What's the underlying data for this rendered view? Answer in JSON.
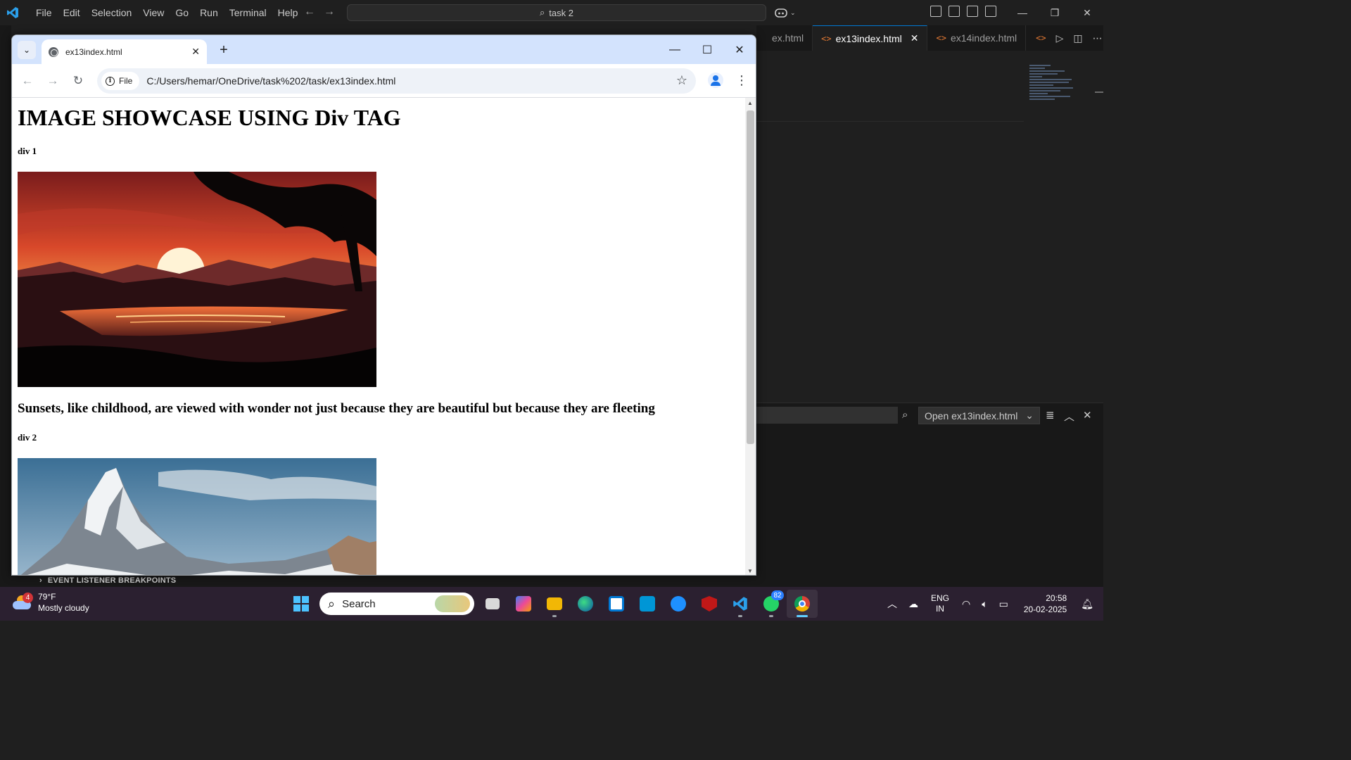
{
  "vscode": {
    "menu": [
      "File",
      "Edit",
      "Selection",
      "View",
      "Go",
      "Run",
      "Terminal",
      "Help"
    ],
    "command_center": "task 2",
    "tabs": [
      {
        "label": "ex.html",
        "active": false
      },
      {
        "label": "ex13index.html",
        "active": true
      },
      {
        "label": "ex14index.html",
        "active": false
      }
    ],
    "output_dropdown": "Open ex13index.html",
    "breakpoints_label": "EVENT LISTENER BREAKPOINTS",
    "accent": "#0078d4"
  },
  "chrome": {
    "tab_title": "ex13index.html",
    "chip_label": "File",
    "url": "C:/Users/hemar/OneDrive/task%202/task/ex13index.html",
    "tabbar_color": "#d3e3fd"
  },
  "page": {
    "heading": "IMAGE SHOWCASE USING Div TAG",
    "div1_label": "div 1",
    "caption1": "Sunsets, like childhood, are viewed with wonder not just because they are beautiful but because they are fleeting",
    "div2_label": "div 2"
  },
  "taskbar": {
    "weather_badge": "4",
    "temperature": "79°F",
    "condition": "Mostly cloudy",
    "search_label": "Search",
    "whatsapp_badge": "82",
    "lang_top": "ENG",
    "lang_bottom": "IN",
    "time": "20:58",
    "date": "20-02-2025"
  }
}
